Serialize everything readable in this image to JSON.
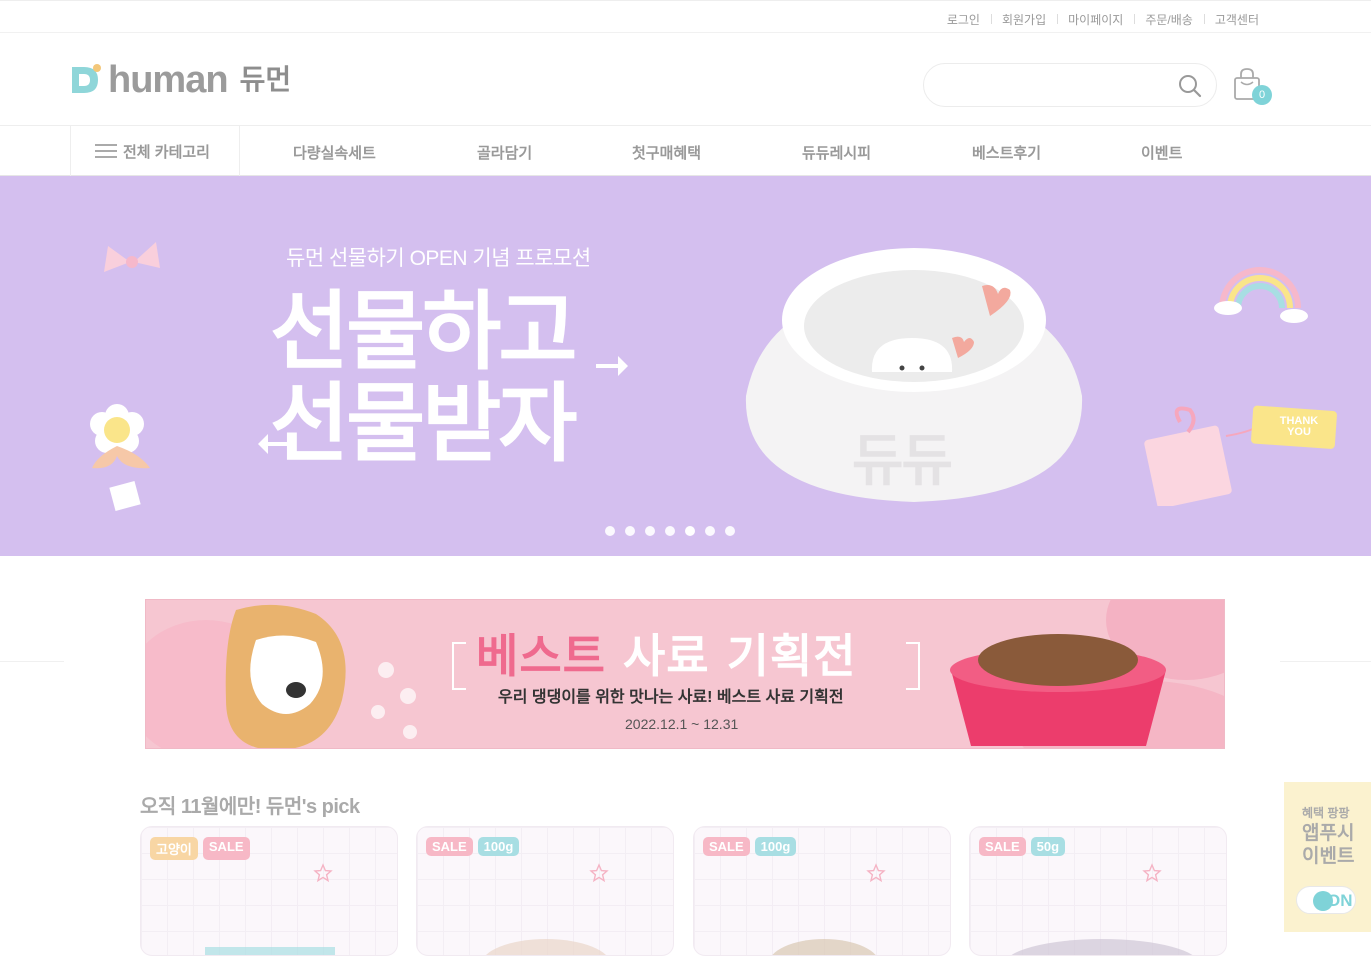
{
  "topbar": {
    "links": [
      "로그인",
      "회원가입",
      "마이페이지",
      "주문/배송",
      "고객센터"
    ]
  },
  "header": {
    "logo_text": "human",
    "logo_ko": "듀먼",
    "search_placeholder": "",
    "cart_count": "0"
  },
  "nav": {
    "all_category": "전체 카테고리",
    "items": [
      "다량실속세트",
      "골라담기",
      "첫구매혜택",
      "듀듀레시피",
      "베스트후기",
      "이벤트"
    ]
  },
  "hero": {
    "subtitle": "듀먼 선물하기 OPEN 기념 프로모션",
    "title_line1": "선물하고",
    "title_line2": "선물받자",
    "bowl_text": "듀듀",
    "tag_text_1": "THANK",
    "tag_text_2": "YOU",
    "slides": 7,
    "active_slide": 5
  },
  "promo": {
    "title_pink": "베스트",
    "title_white": "사료 기획전",
    "subtitle": "우리 댕댕이를 위한 맛나는 사료! 베스트 사료 기획전",
    "date": "2022.12.1 ~ 12.31"
  },
  "picks": {
    "title": "오직 11월에만! 듀먼's pick",
    "cards": [
      {
        "badges": [
          {
            "text": "고양이",
            "kind": "cat"
          },
          {
            "text": "SALE",
            "kind": "sale"
          }
        ]
      },
      {
        "badges": [
          {
            "text": "SALE",
            "kind": "sale"
          },
          {
            "text": "100g",
            "kind": "weight"
          }
        ]
      },
      {
        "badges": [
          {
            "text": "SALE",
            "kind": "sale"
          },
          {
            "text": "100g",
            "kind": "weight"
          }
        ]
      },
      {
        "badges": [
          {
            "text": "SALE",
            "kind": "sale"
          },
          {
            "text": "50g",
            "kind": "weight"
          }
        ]
      }
    ]
  },
  "float_event": {
    "line1": "혜택 팡팡",
    "line2": "앱푸시 이벤트",
    "toggle": "ON"
  },
  "colors": {
    "hero_bg": "#d4bfef",
    "accent": "#7fd3d8",
    "promo_bg": "#f6c6d1",
    "promo_pink": "#ef6a8e"
  }
}
